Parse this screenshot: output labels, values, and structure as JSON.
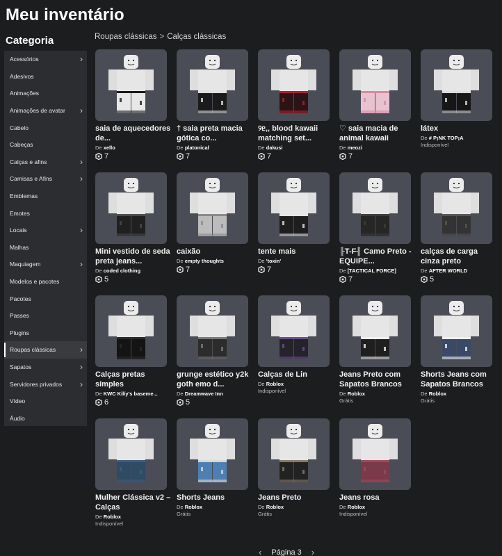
{
  "page_title": "Meu inventário",
  "sidebar": {
    "title": "Categoria",
    "items": [
      {
        "label": "Acessórios",
        "chevron": true,
        "active": false
      },
      {
        "label": "Adesivos",
        "chevron": false,
        "active": false
      },
      {
        "label": "Animações",
        "chevron": false,
        "active": false
      },
      {
        "label": "Animações de avatar",
        "chevron": true,
        "active": false
      },
      {
        "label": "Cabelo",
        "chevron": false,
        "active": false
      },
      {
        "label": "Cabeças",
        "chevron": false,
        "active": false
      },
      {
        "label": "Calças e afins",
        "chevron": true,
        "active": false
      },
      {
        "label": "Camisas e Afins",
        "chevron": true,
        "active": false
      },
      {
        "label": "Emblemas",
        "chevron": false,
        "active": false
      },
      {
        "label": "Emotes",
        "chevron": false,
        "active": false
      },
      {
        "label": "Locais",
        "chevron": true,
        "active": false
      },
      {
        "label": "Malhas",
        "chevron": false,
        "active": false
      },
      {
        "label": "Maquiagem",
        "chevron": true,
        "active": false
      },
      {
        "label": "Modelos e pacotes",
        "chevron": false,
        "active": false
      },
      {
        "label": "Pacotes",
        "chevron": false,
        "active": false
      },
      {
        "label": "Passes",
        "chevron": false,
        "active": false
      },
      {
        "label": "Plugins",
        "chevron": false,
        "active": false
      },
      {
        "label": "Roupas clássicas",
        "chevron": true,
        "active": true
      },
      {
        "label": "Sapatos",
        "chevron": true,
        "active": false
      },
      {
        "label": "Servidores privados",
        "chevron": true,
        "active": false
      },
      {
        "label": "Vídeo",
        "chevron": false,
        "active": false
      },
      {
        "label": "Áudio",
        "chevron": false,
        "active": false
      }
    ]
  },
  "breadcrumb": {
    "parent": "Roupas clássicas",
    "separator": ">",
    "current": "Calças clássicas"
  },
  "creator_prefix": "De",
  "items": [
    {
      "name": "saia de aquecedores de...",
      "creator": "xello",
      "price": "7",
      "status": "",
      "pants_color": "#e8e8e8",
      "accent_color": "#1a1a1a"
    },
    {
      "name": "† saia preta macia gótica co...",
      "creator": "platonical",
      "price": "7",
      "status": "",
      "pants_color": "#1b1b1b",
      "accent_color": "#e0e0e0"
    },
    {
      "name": "୨ᥱ‚‚ blood kawaii matching set...",
      "creator": "dakusi",
      "price": "7",
      "status": "",
      "pants_color": "#2a1416",
      "accent_color": "#b02030"
    },
    {
      "name": "♡ saia macia de animal kawaii",
      "creator": "meozi",
      "price": "7",
      "status": "",
      "pants_color": "#e8c2cf",
      "accent_color": "#d88aa3"
    },
    {
      "name": "látex",
      "creator": "# P¡NK TOP¡A",
      "price": "",
      "status": "Indisponível",
      "pants_color": "#161616",
      "accent_color": "#dcdcdc"
    },
    {
      "name": "Mini vestido de seda preta jeans...",
      "creator": "coded clothing",
      "price": "5",
      "status": "",
      "pants_color": "#202020",
      "accent_color": "#4a4a4a"
    },
    {
      "name": "caixão",
      "creator": "empty thoughts",
      "price": "7",
      "status": "",
      "pants_color": "#bcbcbc",
      "accent_color": "#8a8a8a"
    },
    {
      "name": "tente mais",
      "creator": "'toxin'",
      "price": "7",
      "status": "",
      "pants_color": "#1e1e1e",
      "accent_color": "#e4e4e4"
    },
    {
      "name": "╟T-F╢ Camo Preto - EQUIPE...",
      "creator": "[TACTICAL FORCE]",
      "price": "7",
      "status": "",
      "pants_color": "#262626",
      "accent_color": "#3c3c3c"
    },
    {
      "name": "calças de carga cinza preto",
      "creator": "AFTER WORLD",
      "price": "5",
      "status": "",
      "pants_color": "#333333",
      "accent_color": "#555555"
    },
    {
      "name": "Calças pretas simples",
      "creator": "KWC Kilíy's baseme...",
      "price": "6",
      "status": "",
      "pants_color": "#141414",
      "accent_color": "#2a2a2a"
    },
    {
      "name": "grunge estético y2k goth emo d...",
      "creator": "Dreamwave Inn",
      "price": "5",
      "status": "",
      "pants_color": "#2c2c2c",
      "accent_color": "#7a7a7a"
    },
    {
      "name": "Calças de Lin",
      "creator": "Roblox",
      "price": "",
      "status": "Indisponível",
      "pants_color": "#24222b",
      "accent_color": "#6b4f8c"
    },
    {
      "name": "Jeans Preto com Sapatos Brancos",
      "creator": "Roblox",
      "price": "",
      "status": "Grátis",
      "pants_color": "#1f1f1f",
      "accent_color": "#f0f0f0"
    },
    {
      "name": "Shorts Jeans com Sapatos Brancos",
      "creator": "Roblox",
      "price": "",
      "status": "Grátis",
      "pants_color": "#3a4a66",
      "accent_color": "#f0f0f0"
    },
    {
      "name": "Mulher Clássica v2 – Calças",
      "creator": "Roblox",
      "price": "",
      "status": "Indisponível",
      "pants_color": "#2f4a63",
      "accent_color": "#3f5f80"
    },
    {
      "name": "Shorts Jeans",
      "creator": "Roblox",
      "price": "",
      "status": "Grátis",
      "pants_color": "#4d7fb3",
      "accent_color": "#d8d8d8"
    },
    {
      "name": "Jeans Preto",
      "creator": "Roblox",
      "price": "",
      "status": "Grátis",
      "pants_color": "#222222",
      "accent_color": "#8a7a66"
    },
    {
      "name": "Jeans rosa",
      "creator": "Roblox",
      "price": "",
      "status": "Indisponível",
      "pants_color": "#7a3a4a",
      "accent_color": "#a04a5c"
    }
  ],
  "pagination": {
    "label": "Página 3",
    "prev": "‹",
    "next": "›"
  },
  "colors": {
    "background": "#1c1d1f",
    "sidebar": "#2b2d30",
    "thumbnail": "#4a4d55"
  }
}
